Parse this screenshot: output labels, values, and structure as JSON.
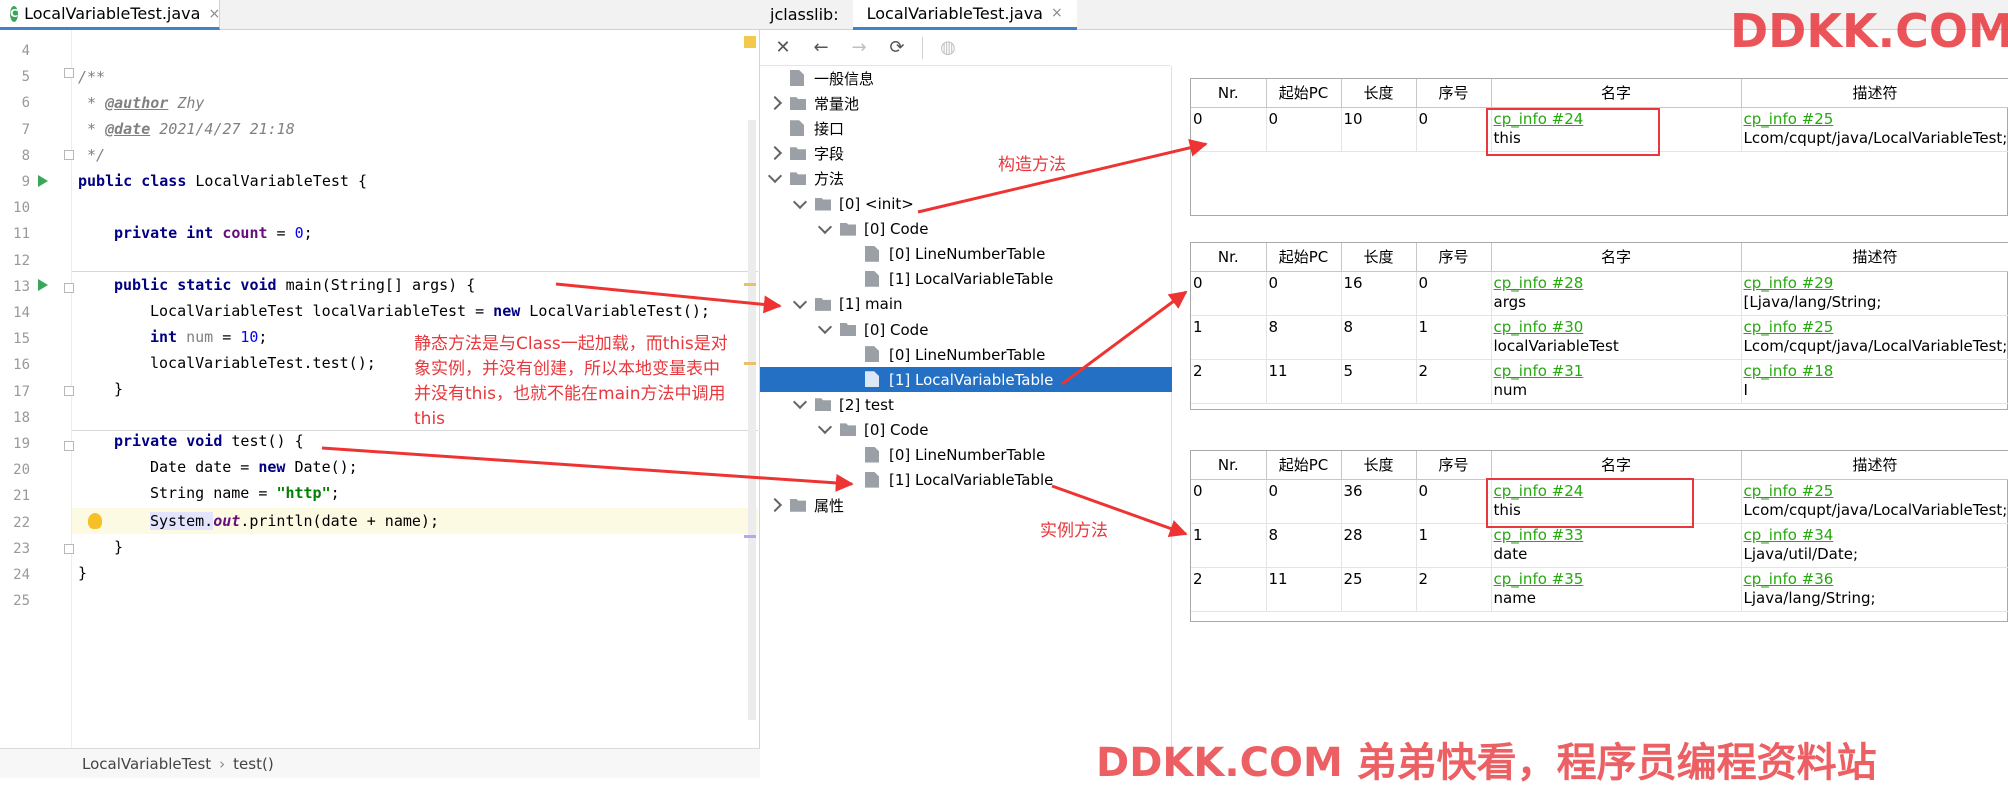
{
  "editor": {
    "tab_label": "LocalVariableTest.java",
    "tab_close": "×",
    "breadcrumb": [
      "LocalVariableTest",
      "test()"
    ],
    "lines": [
      {
        "no": "4"
      },
      {
        "no": "5",
        "text": "/**"
      },
      {
        "no": "6",
        "pre": " * ",
        "tag": "@author",
        "post": " Zhy"
      },
      {
        "no": "7",
        "pre": " * ",
        "tag": "@date",
        "post": " 2021/4/27 21:18"
      },
      {
        "no": "8",
        "text": " */"
      },
      {
        "no": "9"
      },
      {
        "no": "10"
      },
      {
        "no": "11"
      },
      {
        "no": "12"
      },
      {
        "no": "13"
      },
      {
        "no": "14"
      },
      {
        "no": "15"
      },
      {
        "no": "16"
      },
      {
        "no": "17"
      },
      {
        "no": "18"
      },
      {
        "no": "19"
      },
      {
        "no": "20"
      },
      {
        "no": "21"
      },
      {
        "no": "22"
      },
      {
        "no": "23"
      },
      {
        "no": "24"
      },
      {
        "no": "25"
      }
    ],
    "code": {
      "l9_kw": "public class",
      "l9_rest": " LocalVariableTest {",
      "l11_kw1": "private",
      "l11_kw2": "int",
      "l11_field": "count",
      "l11_eq": " = ",
      "l11_num": "0",
      "l11_end": ";",
      "l13_kw": "public static void",
      "l13_rest": " main(String[] args) {",
      "l14_a": "LocalVariableTest localVariableTest = ",
      "l14_kw": "new",
      "l14_b": " LocalVariableTest();",
      "l15_kw": "int",
      "l15_var": " num",
      "l15_eq": " = ",
      "l15_num": "10",
      "l15_end": ";",
      "l16": "localVariableTest.test();",
      "l17": "}",
      "l19_kw": "private void",
      "l19_rest": " test() {",
      "l20_a": "Date date = ",
      "l20_kw": "new",
      "l20_b": " Date();",
      "l21_a": "String name = ",
      "l21_str": "\"http\"",
      "l21_end": ";",
      "l22_a": "System.",
      "l22_out": "out",
      "l22_b": ".println(date + name);",
      "l23": "}",
      "l24": "}"
    }
  },
  "annotations": {
    "static_note": "静态方法是与Class一起加载，而this是对象实例，并没有创建，所以本地变量表中并没有this，也就不能在main方法中调用this",
    "constructor": "构造方法",
    "instance": "实例方法",
    "watermark_top": "DDKK.COM",
    "watermark_bottom": "DDKK.COM 弟弟快看，程序员编程资料站"
  },
  "jclasslib": {
    "title": "jclasslib:",
    "tab_label": "LocalVariableTest.java",
    "tab_close": "×",
    "toolbar": {
      "close": "✕",
      "back": "←",
      "forward": "→",
      "refresh": "⟳",
      "browser": "◍"
    },
    "tree": [
      {
        "label": "一般信息"
      },
      {
        "label": "常量池"
      },
      {
        "label": "接口"
      },
      {
        "label": "字段"
      },
      {
        "label": "方法"
      },
      {
        "label": "[0] <init>"
      },
      {
        "label": "[0] Code"
      },
      {
        "label": "[0] LineNumberTable"
      },
      {
        "label": "[1] LocalVariableTable"
      },
      {
        "label": "[1] main"
      },
      {
        "label": "[0] Code"
      },
      {
        "label": "[0] LineNumberTable"
      },
      {
        "label": "[1] LocalVariableTable"
      },
      {
        "label": "[2] test"
      },
      {
        "label": "[0] Code"
      },
      {
        "label": "[0] LineNumberTable"
      },
      {
        "label": "[1] LocalVariableTable"
      },
      {
        "label": "属性"
      }
    ],
    "columns": [
      "Nr.",
      "起始PC",
      "长度",
      "序号",
      "名字",
      "描述符"
    ],
    "tables": [
      {
        "rows": [
          {
            "nr": "0",
            "pc": "0",
            "len": "10",
            "idx": "0",
            "name_ref": "cp_info #24",
            "name": "this",
            "desc_ref": "cp_info #25",
            "desc": "Lcom/cqupt/java/LocalVariableTest;"
          }
        ]
      },
      {
        "rows": [
          {
            "nr": "0",
            "pc": "0",
            "len": "16",
            "idx": "0",
            "name_ref": "cp_info #28",
            "name": "args",
            "desc_ref": "cp_info #29",
            "desc": "[Ljava/lang/String;"
          },
          {
            "nr": "1",
            "pc": "8",
            "len": "8",
            "idx": "1",
            "name_ref": "cp_info #30",
            "name": "localVariableTest",
            "desc_ref": "cp_info #25",
            "desc": "Lcom/cqupt/java/LocalVariableTest;"
          },
          {
            "nr": "2",
            "pc": "11",
            "len": "5",
            "idx": "2",
            "name_ref": "cp_info #31",
            "name": "num",
            "desc_ref": "cp_info #18",
            "desc": "I"
          }
        ]
      },
      {
        "rows": [
          {
            "nr": "0",
            "pc": "0",
            "len": "36",
            "idx": "0",
            "name_ref": "cp_info #24",
            "name": "this",
            "desc_ref": "cp_info #25",
            "desc": "Lcom/cqupt/java/LocalVariableTest;"
          },
          {
            "nr": "1",
            "pc": "8",
            "len": "28",
            "idx": "1",
            "name_ref": "cp_info #33",
            "name": "date",
            "desc_ref": "cp_info #34",
            "desc": "Ljava/util/Date;"
          },
          {
            "nr": "2",
            "pc": "11",
            "len": "25",
            "idx": "2",
            "name_ref": "cp_info #35",
            "name": "name",
            "desc_ref": "cp_info #36",
            "desc": "Ljava/lang/String;"
          }
        ]
      }
    ]
  }
}
